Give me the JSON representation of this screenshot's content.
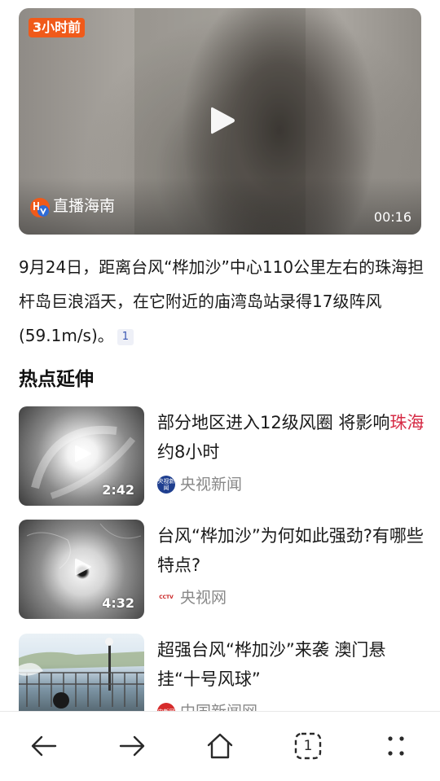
{
  "hero": {
    "time_badge": "3小时前",
    "source": "直播海南",
    "duration": "00:16"
  },
  "summary": {
    "text": "9月24日，距离台风“桦加沙”中心110公里左右的珠海担杆岛巨浪滔天，在它附近的庙湾岛站录得17级阵风(59.1m/s)。",
    "ref": "1"
  },
  "section": {
    "title": "热点延伸"
  },
  "news": [
    {
      "title_before": "部分地区进入12级风圈 将影响",
      "title_highlight": "珠海",
      "title_after": "约8小时",
      "source": "央视新闻",
      "logo_text": "央视新闻",
      "duration": "2:42"
    },
    {
      "title_before": "台风“桦加沙”为何如此强劲?有哪些特点?",
      "title_highlight": "",
      "title_after": "",
      "source": "央视网",
      "logo_text": "CCTV",
      "duration": "4:32"
    },
    {
      "title_before": "超强台风“桦加沙”来袭 澳门悬挂“十号风球”",
      "title_highlight": "",
      "title_after": "",
      "source": "中国新闻网",
      "logo_text": "中新网",
      "duration": ""
    }
  ],
  "bottom_nav": {
    "tab_count": "1"
  },
  "colors": {
    "time_badge": "#f05a1a",
    "highlight": "#d62b45",
    "ref_chip_bg": "#eef0f7",
    "ref_chip_text": "#3a57b3",
    "source_text": "#888888"
  },
  "icons": {
    "hero_play": "play-icon",
    "thumb_play": "play-icon",
    "back": "arrow-left-icon",
    "forward": "arrow-right-icon",
    "home": "home-icon",
    "tabs": "tabs-icon",
    "more": "more-dots-icon"
  }
}
